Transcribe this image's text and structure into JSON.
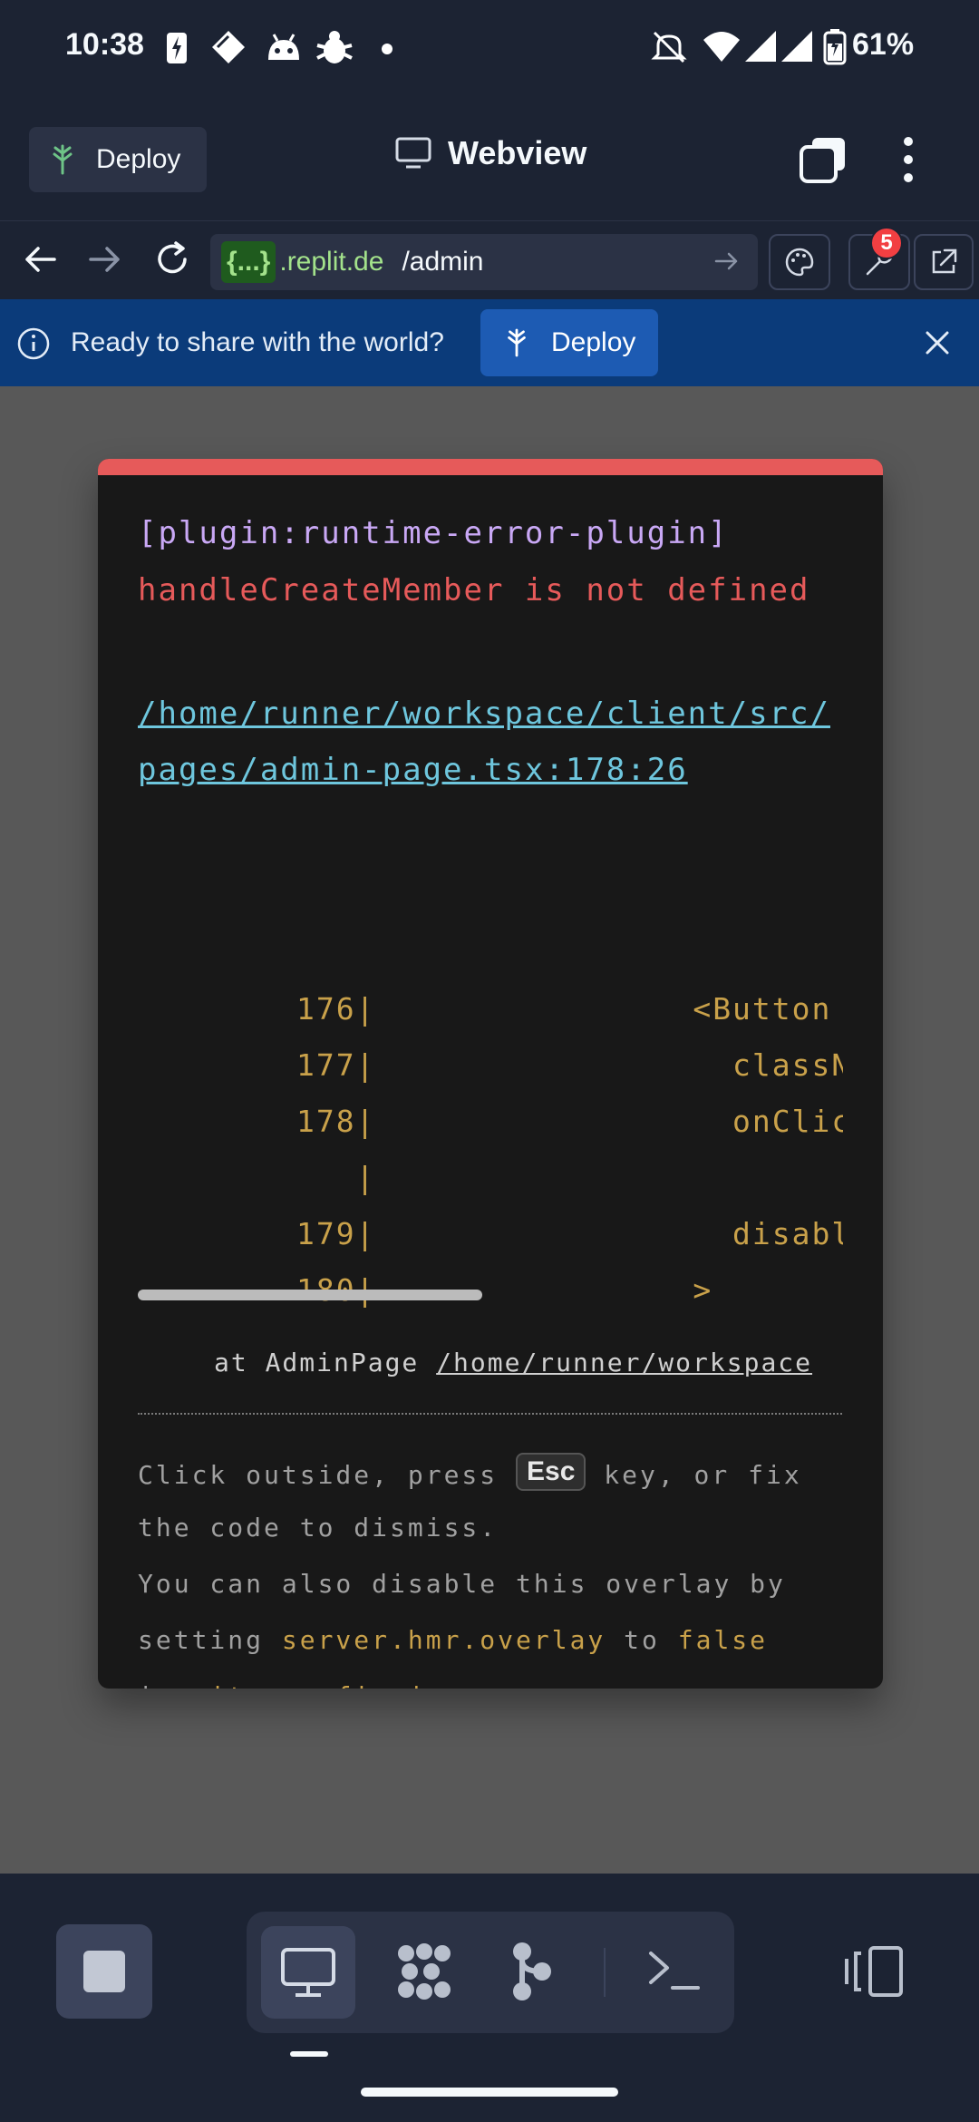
{
  "status_bar": {
    "time": "10:38",
    "battery": "61%"
  },
  "header": {
    "deploy_label": "Deploy",
    "title": "Webview"
  },
  "url_bar": {
    "brace": "{...}",
    "domain": ".replit.de",
    "path": "/admin",
    "badge_count": "5"
  },
  "banner": {
    "text": "Ready to share with the world?",
    "deploy_label": "Deploy"
  },
  "overlay": {
    "plugin": "[plugin:runtime-error-plugin]",
    "message": "handleCreateMember is not defined",
    "file_link": "/home/runner/workspace/client/src/pages/admin-page.tsx:178:26",
    "code_lines": [
      {
        "num": "176",
        "text": "                <Button"
      },
      {
        "num": "177",
        "text": "                  className"
      },
      {
        "num": "178",
        "text": "                  onClick={"
      },
      {
        "num": "",
        "text": ""
      },
      {
        "num": "179",
        "text": "                  disabled="
      },
      {
        "num": "180",
        "text": "                >"
      }
    ],
    "stack_prefix": "at AdminPage ",
    "stack_link": "/home/runner/workspace",
    "tip_line1_a": "Click outside, press ",
    "esc_key": "Esc",
    "tip_line1_b": " key, or fix",
    "tip_line2": "the code to dismiss.",
    "tip_line3": "You can also disable this overlay by",
    "tip_line4_a": "setting ",
    "tip_line4_hl1": "server.hmr.overlay",
    "tip_line4_b": " to ",
    "tip_line4_hl2": "false",
    "tip_line5_a": "in ",
    "tip_line5_hl": "vite.config.js",
    "tip_line5_b": "."
  },
  "colors": {
    "error_red": "#e65a5a",
    "link_cyan": "#6ec6dd",
    "code_amber": "#c9a14a",
    "plugin_purple": "#c9a8f5"
  },
  "icons": {
    "status": [
      "charging-icon",
      "diamond-icon",
      "android-head-icon",
      "bug-icon",
      "dot-icon",
      "muted-icon",
      "wifi-icon",
      "signal-icon",
      "battery-icon"
    ],
    "bottom": [
      "stop-icon",
      "monitor-icon",
      "grid-dots-icon",
      "branch-icon",
      "terminal-icon",
      "split-view-icon"
    ]
  }
}
